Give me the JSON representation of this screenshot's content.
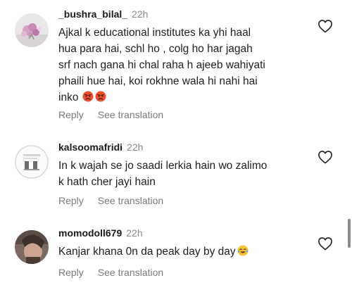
{
  "comments": [
    {
      "username": "_bushra_bilal_",
      "time": "22h",
      "text": "Ajkal k educational institutes ka yhi haal\nhua para hai, schl ho , colg ho har jagah\nsrf nach gana hi chal raha h ajeeb wahiyati\nphaili hue hai, koi rokhne wala hi nahi hai\ninko",
      "emojis": [
        "pouting-face-emoji",
        "pouting-face-emoji"
      ],
      "reply_label": "Reply",
      "translate_label": "See translation"
    },
    {
      "username": "kalsoomafridi",
      "time": "22h",
      "text": "In k wajah se jo saadi lerkia hain wo zalimo\nk hath cher jayi hain",
      "emojis": [],
      "reply_label": "Reply",
      "translate_label": "See translation"
    },
    {
      "username": "momodoll679",
      "time": "22h",
      "text": "Kanjar khana 0n da peak day by day",
      "emojis": [
        "tears-of-joy-emoji"
      ],
      "reply_label": "Reply",
      "translate_label": "See translation"
    }
  ],
  "colors": {
    "text": "#1c1c1c",
    "muted": "#8a8a8a",
    "heart_outline": "#262626",
    "scrollbar": "#8c8c8c"
  }
}
